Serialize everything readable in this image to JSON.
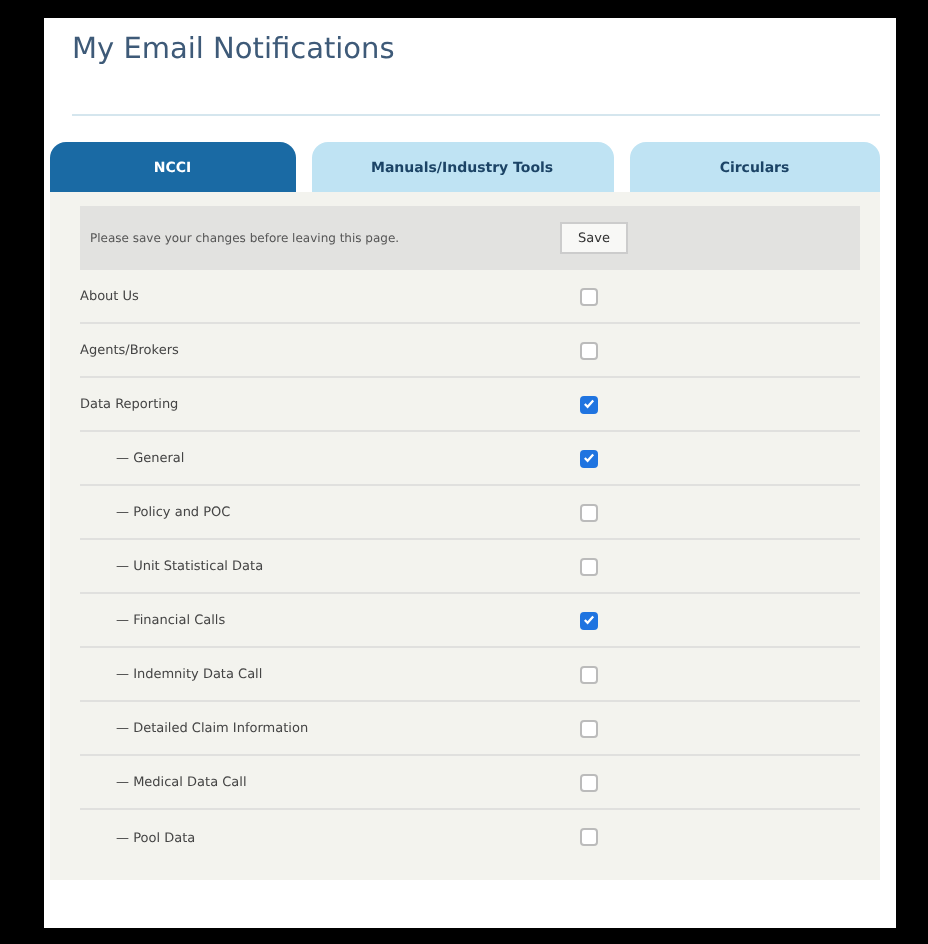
{
  "title": "My Email Notifications",
  "tabs": [
    {
      "label": "NCCI",
      "selected": true
    },
    {
      "label": "Manuals/Industry Tools",
      "selected": false
    },
    {
      "label": "Circulars",
      "selected": false
    }
  ],
  "notice": {
    "text": "Please save your changes before leaving this page.",
    "button": "Save"
  },
  "items": [
    {
      "label": "About Us",
      "checked": false
    },
    {
      "label": "Agents/Brokers",
      "checked": false
    },
    {
      "label": "Data Reporting",
      "checked": true,
      "children": [
        {
          "label": "— General",
          "checked": true
        },
        {
          "label": "— Policy and POC",
          "checked": false
        },
        {
          "label": "— Unit Statistical Data",
          "checked": false
        },
        {
          "label": "— Financial Calls",
          "checked": true
        },
        {
          "label": "— Indemnity Data Call",
          "checked": false
        },
        {
          "label": "— Detailed Claim Information",
          "checked": false
        },
        {
          "label": "— Medical Data Call",
          "checked": false
        },
        {
          "label": "— Pool Data",
          "checked": false
        }
      ]
    }
  ]
}
